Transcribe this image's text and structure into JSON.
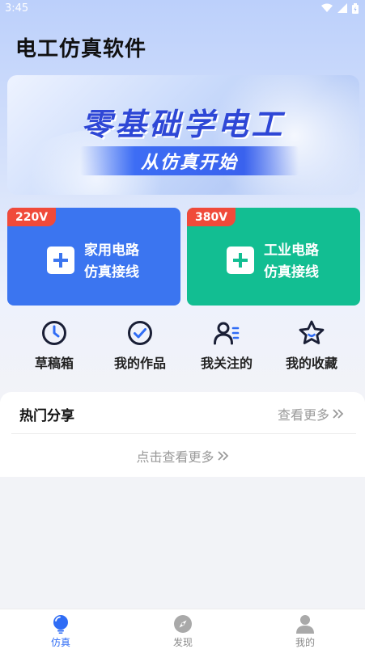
{
  "status_bar": {
    "time": "3:45"
  },
  "app": {
    "title": "电工仿真软件"
  },
  "banner": {
    "title": "零基础学电工",
    "subtitle": "从仿真开始"
  },
  "cards": [
    {
      "badge": "220V",
      "line1": "家用电路",
      "line2": "仿真接线",
      "color": "#3b75f0"
    },
    {
      "badge": "380V",
      "line1": "工业电路",
      "line2": "仿真接线",
      "color": "#12be92"
    }
  ],
  "quick_actions": [
    {
      "label": "草稿箱",
      "icon": "clock-icon"
    },
    {
      "label": "我的作品",
      "icon": "check-circle-icon"
    },
    {
      "label": "我关注的",
      "icon": "user-list-icon"
    },
    {
      "label": "我的收藏",
      "icon": "star-icon"
    }
  ],
  "hot_share": {
    "title": "热门分享",
    "more": "查看更多",
    "see_more": "点击查看更多"
  },
  "tabs": [
    {
      "label": "仿真",
      "icon": "bulb-icon",
      "active": true
    },
    {
      "label": "发现",
      "icon": "compass-icon",
      "active": false
    },
    {
      "label": "我的",
      "icon": "person-icon",
      "active": false
    }
  ],
  "colors": {
    "accent": "#2f6cf5",
    "badge": "#f04a3a",
    "home_card": "#3b75f0",
    "industry_card": "#12be92"
  }
}
